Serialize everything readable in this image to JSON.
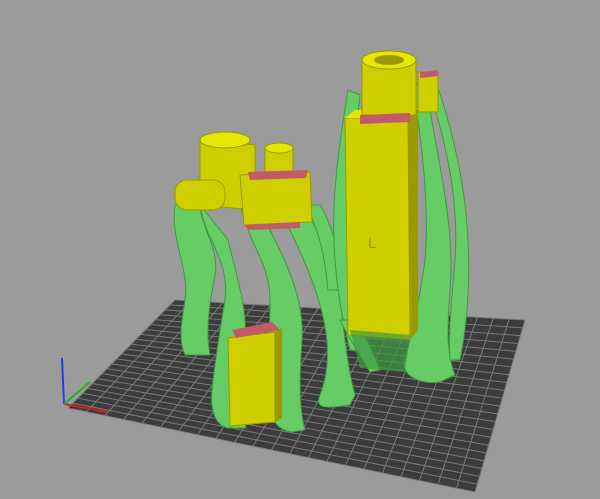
{
  "viewport": {
    "background": "#9b9b9b",
    "bed_color": "#3c3c3c",
    "bed_grid_color": "#7a7a7a"
  },
  "colors": {
    "support": "#66cc66",
    "support_dark": "#3f9a3f",
    "model": "#cfcf00",
    "model_light": "#e6e600",
    "model_dark": "#9a9a00",
    "overhang": "#c25a6a"
  },
  "axes": {
    "x_color": "#d02020",
    "y_color": "#20b020",
    "z_color": "#2040e0"
  }
}
